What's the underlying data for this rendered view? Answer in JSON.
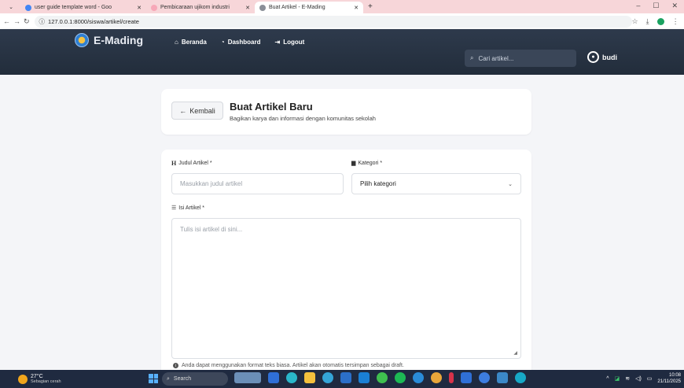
{
  "browser": {
    "tabs": [
      {
        "label": "user guide template word - Goo",
        "favicon_color": "#4285f4",
        "active": false
      },
      {
        "label": "Pembicaraan ujikom industri",
        "favicon_color": "#f7a8b8",
        "active": false
      },
      {
        "label": "Buat Artikel - E-Mading",
        "favicon_color": "#8a8f98",
        "active": true
      }
    ],
    "new_tab": "+",
    "url": "127.0.0.1:8000/siswa/artikel/create",
    "window_controls": [
      "–",
      "☐",
      "✕"
    ]
  },
  "navbar": {
    "brand": "E-Mading",
    "links": [
      {
        "icon": "home-icon",
        "label": "Beranda"
      },
      {
        "icon": "dashboard-icon",
        "label": "Dashboard"
      },
      {
        "icon": "logout-icon",
        "label": "Logout"
      }
    ],
    "search_placeholder": "Cari artikel...",
    "username": "budi"
  },
  "header_card": {
    "back_label": "Kembali",
    "title": "Buat Artikel Baru",
    "subtitle": "Bagikan karya dan informasi dengan komunitas sekolah"
  },
  "form": {
    "title_label": "Judul Artikel *",
    "title_placeholder": "Masukkan judul artikel",
    "category_label": "Kategori *",
    "category_selected": "Pilih kategori",
    "content_label": "Isi Artikel *",
    "content_placeholder": "Tulis isi artikel di sini...",
    "hint": "Anda dapat menggunakan format teks biasa. Artikel akan otomatis tersimpan sebagai draft."
  },
  "taskbar": {
    "temperature": "27°C",
    "weather": "Sebagian cerah",
    "search_label": "Search",
    "time": "10:08",
    "date": "21/11/2025"
  },
  "colors": {
    "navbar_bg": "#2a3545",
    "tab_strip": "#f7d6d9",
    "taskbar": "#1f2a40"
  }
}
